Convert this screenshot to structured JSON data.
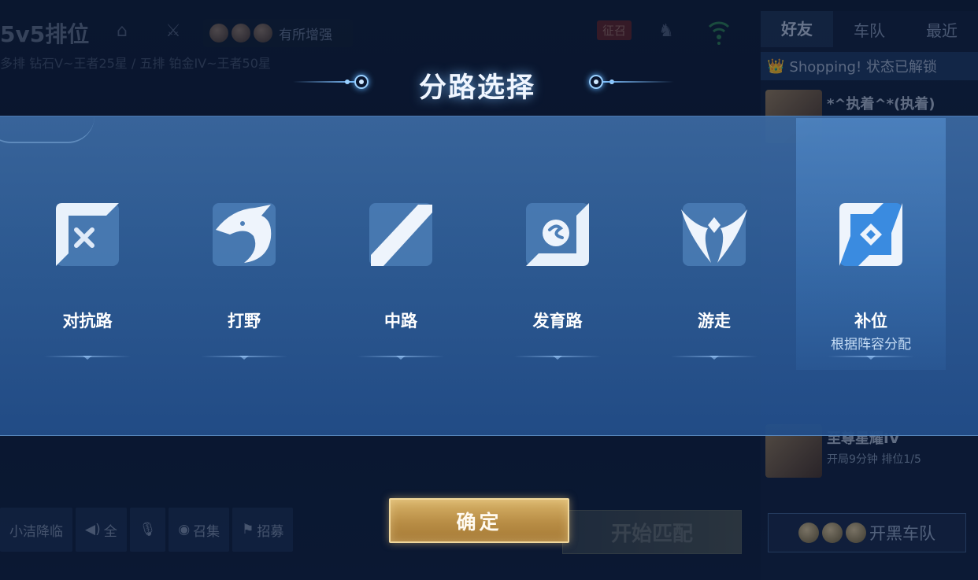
{
  "lobby": {
    "mode_title": "5v5排位",
    "rank_info": "多排 钻石V~王者25星 / 五排 铂金IV~王者50星",
    "hero_group_label": "有所增强",
    "summon_badge": "征召",
    "social_tabs": [
      "好友",
      "车队",
      "最近"
    ],
    "shop_text": "Shopping!  状态已解锁",
    "friend_1_name": "*^执着^*(执着)",
    "friend_2_name": "至尊星耀IV",
    "friend_2_status": "开局9分钟 排位1/5",
    "bottom_buttons": [
      "小洁降临",
      "全",
      "",
      "召集",
      "招募"
    ],
    "start_match": "开始匹配",
    "team_button": "开黑车队"
  },
  "dialog": {
    "title": "分路选择",
    "lanes": [
      {
        "label": "对抗路",
        "sub": "",
        "icon": "clash-lane-icon"
      },
      {
        "label": "打野",
        "sub": "",
        "icon": "jungle-icon"
      },
      {
        "label": "中路",
        "sub": "",
        "icon": "mid-lane-icon"
      },
      {
        "label": "发育路",
        "sub": "",
        "icon": "farm-lane-icon"
      },
      {
        "label": "游走",
        "sub": "",
        "icon": "roam-icon"
      },
      {
        "label": "补位",
        "sub": "根据阵容分配",
        "icon": "fill-icon"
      }
    ],
    "selected_lane": "补位",
    "confirm_label": "确定"
  },
  "colors": {
    "accent_gold": "#c9a055",
    "panel_blue": "#3a68a0",
    "title_glow": "#7fc0ff"
  }
}
